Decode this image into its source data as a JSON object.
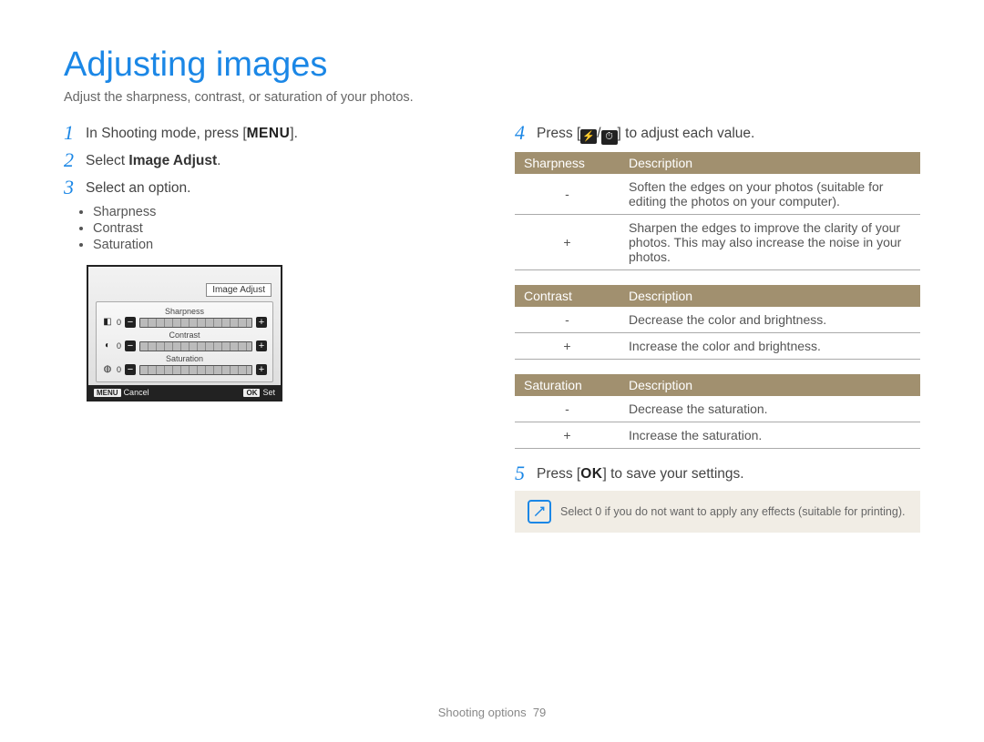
{
  "title": "Adjusting images",
  "subtitle": "Adjust the sharpness, contrast, or saturation of your photos.",
  "left": {
    "steps": [
      {
        "num": "1",
        "text_before": "In Shooting mode, press [",
        "key": "MENU",
        "text_after": "]."
      },
      {
        "num": "2",
        "text_before": "Select ",
        "bold": "Image Adjust",
        "text_after": "."
      },
      {
        "num": "3",
        "text_before": "Select an option."
      }
    ],
    "bullets": [
      "Sharpness",
      "Contrast",
      "Saturation"
    ],
    "screen": {
      "title": "Image Adjust",
      "rows": [
        {
          "label": "Sharpness",
          "icon": "◧",
          "zero": "0"
        },
        {
          "label": "Contrast",
          "icon": "◐",
          "zero": "0"
        },
        {
          "label": "Saturation",
          "icon": "◍",
          "zero": "0"
        }
      ],
      "bottom_left_key": "MENU",
      "bottom_left": "Cancel",
      "bottom_right_key": "OK",
      "bottom_right": "Set"
    }
  },
  "right": {
    "step4": {
      "num": "4",
      "before": "Press [",
      "sep": "/",
      "after": "] to adjust each value."
    },
    "tables": [
      {
        "head": [
          "Sharpness",
          "Description"
        ],
        "rows": [
          [
            "-",
            "Soften the edges on your photos (suitable for editing the photos on your computer)."
          ],
          [
            "+",
            "Sharpen the edges to improve the clarity of your photos. This may also increase the noise in your photos."
          ]
        ]
      },
      {
        "head": [
          "Contrast",
          "Description"
        ],
        "rows": [
          [
            "-",
            "Decrease the color and brightness."
          ],
          [
            "+",
            "Increase the color and brightness."
          ]
        ]
      },
      {
        "head": [
          "Saturation",
          "Description"
        ],
        "rows": [
          [
            "-",
            "Decrease the saturation."
          ],
          [
            "+",
            "Increase the saturation."
          ]
        ]
      }
    ],
    "step5": {
      "num": "5",
      "before": "Press [",
      "key": "OK",
      "after": "] to save your settings."
    },
    "note": "Select 0 if you do not want to apply any effects (suitable for printing)."
  },
  "footer": {
    "section": "Shooting options",
    "page": "79"
  }
}
